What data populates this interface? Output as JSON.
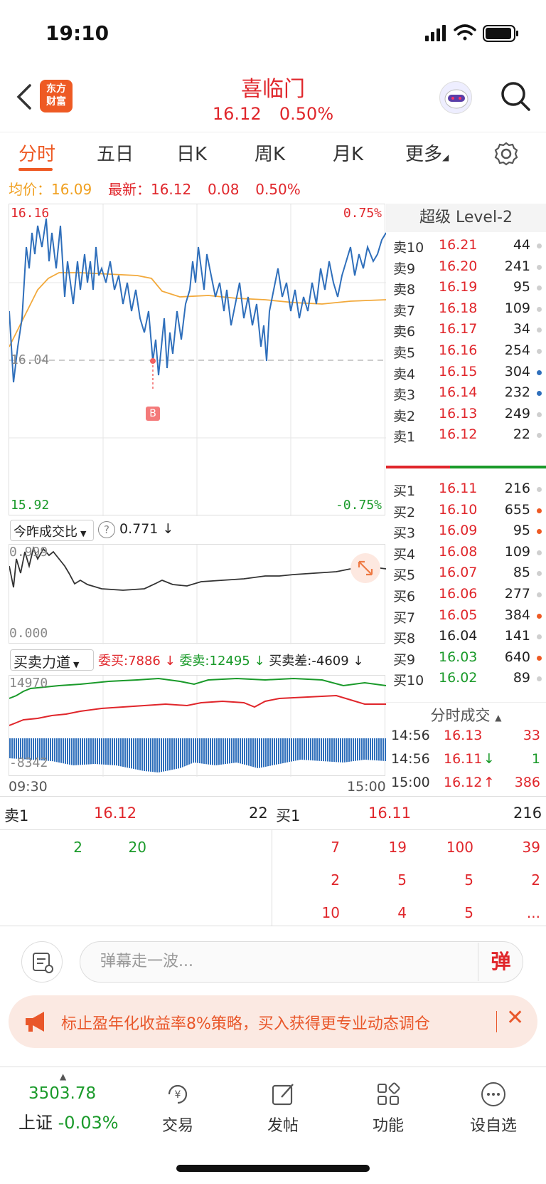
{
  "status": {
    "time": "19:10"
  },
  "header": {
    "logo": [
      "东方",
      "财富"
    ],
    "stock_name": "喜临门",
    "price": "16.12",
    "change_pct": "0.50%"
  },
  "tabs": [
    "分时",
    "五日",
    "日K",
    "周K",
    "月K",
    "更多"
  ],
  "info": {
    "avg_label": "均价：",
    "avg_value": "16.09",
    "latest_label": "最新：",
    "latest_value": "16.12",
    "change": "0.08",
    "change_pct": "0.50%"
  },
  "intraday": {
    "high": "16.16",
    "mid": "16.04",
    "low": "15.92",
    "pct_high": "0.75%",
    "pct_low": "-0.75%",
    "marker": "B"
  },
  "ratio": {
    "label": "今昨成交比",
    "value": "0.771",
    "arrow": "↓",
    "top": "0.999",
    "bottom": "0.000"
  },
  "force": {
    "label": "买卖力道",
    "buy_label": "委买:",
    "buy_value": "7886",
    "sell_label": "委卖:",
    "sell_value": "12495",
    "diff_label": "买卖差:",
    "diff_value": "-4609",
    "top": "14970",
    "bottom": "-8342",
    "start_time": "09:30",
    "end_time": "15:00"
  },
  "orderbook": {
    "title": "超级 Level-2",
    "asks": [
      {
        "label": "卖10",
        "price": "16.21",
        "vol": "44",
        "dot": "gray"
      },
      {
        "label": "卖9",
        "price": "16.20",
        "vol": "241",
        "dot": "gray"
      },
      {
        "label": "卖8",
        "price": "16.19",
        "vol": "95",
        "dot": "gray"
      },
      {
        "label": "卖7",
        "price": "16.18",
        "vol": "109",
        "dot": "gray"
      },
      {
        "label": "卖6",
        "price": "16.17",
        "vol": "34",
        "dot": "gray"
      },
      {
        "label": "卖5",
        "price": "16.16",
        "vol": "254",
        "dot": "gray"
      },
      {
        "label": "卖4",
        "price": "16.15",
        "vol": "304",
        "dot": "blue"
      },
      {
        "label": "卖3",
        "price": "16.14",
        "vol": "232",
        "dot": "blue"
      },
      {
        "label": "卖2",
        "price": "16.13",
        "vol": "249",
        "dot": "gray"
      },
      {
        "label": "卖1",
        "price": "16.12",
        "vol": "22",
        "dot": "gray"
      }
    ],
    "bids": [
      {
        "label": "买1",
        "price": "16.11",
        "vol": "216",
        "dot": "gray",
        "color": "red"
      },
      {
        "label": "买2",
        "price": "16.10",
        "vol": "655",
        "dot": "orange",
        "color": "red"
      },
      {
        "label": "买3",
        "price": "16.09",
        "vol": "95",
        "dot": "orange",
        "color": "red"
      },
      {
        "label": "买4",
        "price": "16.08",
        "vol": "109",
        "dot": "gray",
        "color": "red"
      },
      {
        "label": "买5",
        "price": "16.07",
        "vol": "85",
        "dot": "gray",
        "color": "red"
      },
      {
        "label": "买6",
        "price": "16.06",
        "vol": "277",
        "dot": "gray",
        "color": "red"
      },
      {
        "label": "买7",
        "price": "16.05",
        "vol": "384",
        "dot": "orange",
        "color": "red"
      },
      {
        "label": "买8",
        "price": "16.04",
        "vol": "141",
        "dot": "gray",
        "color": "dark"
      },
      {
        "label": "买9",
        "price": "16.03",
        "vol": "640",
        "dot": "orange",
        "color": "green"
      },
      {
        "label": "买10",
        "price": "16.02",
        "vol": "89",
        "dot": "gray",
        "color": "green"
      }
    ],
    "ticks_title": "分时成交",
    "ticks": [
      {
        "time": "14:56",
        "price": "16.13",
        "vol": "33",
        "arrow": ""
      },
      {
        "time": "14:56",
        "price": "16.11",
        "vol": "1",
        "arrow": "↓"
      },
      {
        "time": "15:00",
        "price": "16.12",
        "vol": "386",
        "arrow": "↑"
      }
    ]
  },
  "queue": {
    "ask_label": "卖1",
    "ask_price": "16.12",
    "ask_vol": "22",
    "bid_label": "买1",
    "bid_price": "16.11",
    "bid_vol": "216",
    "ask_orders": [
      "2",
      "20"
    ],
    "bid_orders": [
      [
        "7",
        "19",
        "100",
        "39"
      ],
      [
        "2",
        "5",
        "5",
        "2"
      ],
      [
        "10",
        "4",
        "5",
        "..."
      ]
    ]
  },
  "comment": {
    "placeholder": "弹幕走一波...",
    "button": "弹"
  },
  "promo": {
    "text": "标止盈年化收益率8%策略，买入获得更专业动态调仓"
  },
  "nav": {
    "index_value": "3503.78",
    "index_name": "上证",
    "index_change": "-0.03%",
    "items": [
      "交易",
      "发帖",
      "功能",
      "设自选"
    ]
  }
}
